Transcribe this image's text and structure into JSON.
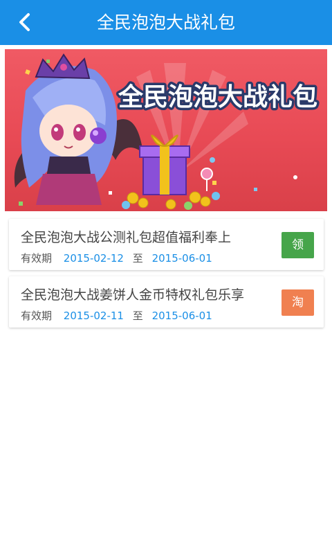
{
  "header": {
    "title": "全民泡泡大战礼包",
    "back_icon": "chevron-left-icon"
  },
  "banner": {
    "title": "全民泡泡大战礼包",
    "image": "game-character-gift-box-banner"
  },
  "gifts": [
    {
      "title": "全民泡泡大战公测礼包超值福利奉上",
      "validity_label": "有效期",
      "start_date": "2015-02-12",
      "to_label": "至",
      "end_date": "2015-06-01",
      "action_label": "领",
      "action_color": "#46a54a"
    },
    {
      "title": "全民泡泡大战姜饼人金币特权礼包乐享",
      "validity_label": "有效期",
      "start_date": "2015-02-11",
      "to_label": "至",
      "end_date": "2015-06-01",
      "action_label": "淘",
      "action_color": "#f08050"
    }
  ],
  "colors": {
    "header_bg": "#1a8fe6",
    "date_text": "#1a8fe6",
    "banner_bg": "#e84a55"
  }
}
